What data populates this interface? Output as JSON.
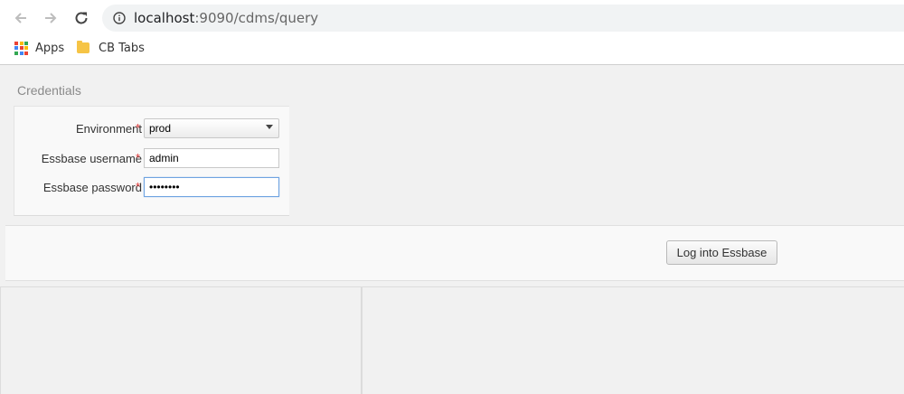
{
  "browser": {
    "url_host": "localhost",
    "url_rest": ":9090/cdms/query",
    "bookmarks": [
      {
        "label": "Apps",
        "icon": "apps-grid-icon"
      },
      {
        "label": "CB Tabs",
        "icon": "folder-icon"
      }
    ]
  },
  "credentials": {
    "title": "Credentials",
    "fields": {
      "environment": {
        "label": "Environment",
        "required": "*",
        "value": "prod"
      },
      "username": {
        "label": "Essbase username",
        "required": "*",
        "value": "admin"
      },
      "password": {
        "label": "Essbase password",
        "required": "*",
        "value": "••••••••"
      }
    }
  },
  "actions": {
    "login_label": "Log into Essbase"
  },
  "colors": {
    "required": "#e03b3b",
    "focus_border": "#6fa4e1"
  }
}
